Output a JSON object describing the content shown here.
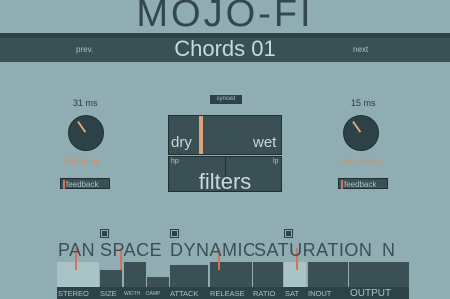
{
  "header": {
    "title": "MOJO-FI",
    "preset": "Chords 01",
    "prev_label": "prev.",
    "next_label": "next"
  },
  "left_delay": {
    "time": "31 ms",
    "label": "left delay",
    "feedback_label": "feedback"
  },
  "right_delay": {
    "time": "15 ms",
    "label": "right delay",
    "feedback_label": "feedback"
  },
  "center": {
    "synced_label": "synced",
    "dry_label": "dry",
    "wet_label": "wet",
    "dry_wet_value": 0.27,
    "filters_label": "filters",
    "hp_label": "hp",
    "lp_label": "lp"
  },
  "modules": {
    "pan": "PAN",
    "space": "SPACE",
    "dynamics": "DYNAMICS",
    "saturation": "SATURATION",
    "eq_tail": "N"
  },
  "bottom_labels": {
    "stereo": "STEREO",
    "size": "SIZE",
    "width": "WIDTH",
    "damp": "DAMP",
    "attack": "ATTACK",
    "release": "RELEASE",
    "ratio": "RATIO",
    "sat": "SAT",
    "inout": "INOUT",
    "output": "OUTPUT"
  },
  "colors": {
    "background": "#8fadb2",
    "panel": "#3a5055",
    "accent": "#e0a07a",
    "marker": "#d4735a"
  }
}
